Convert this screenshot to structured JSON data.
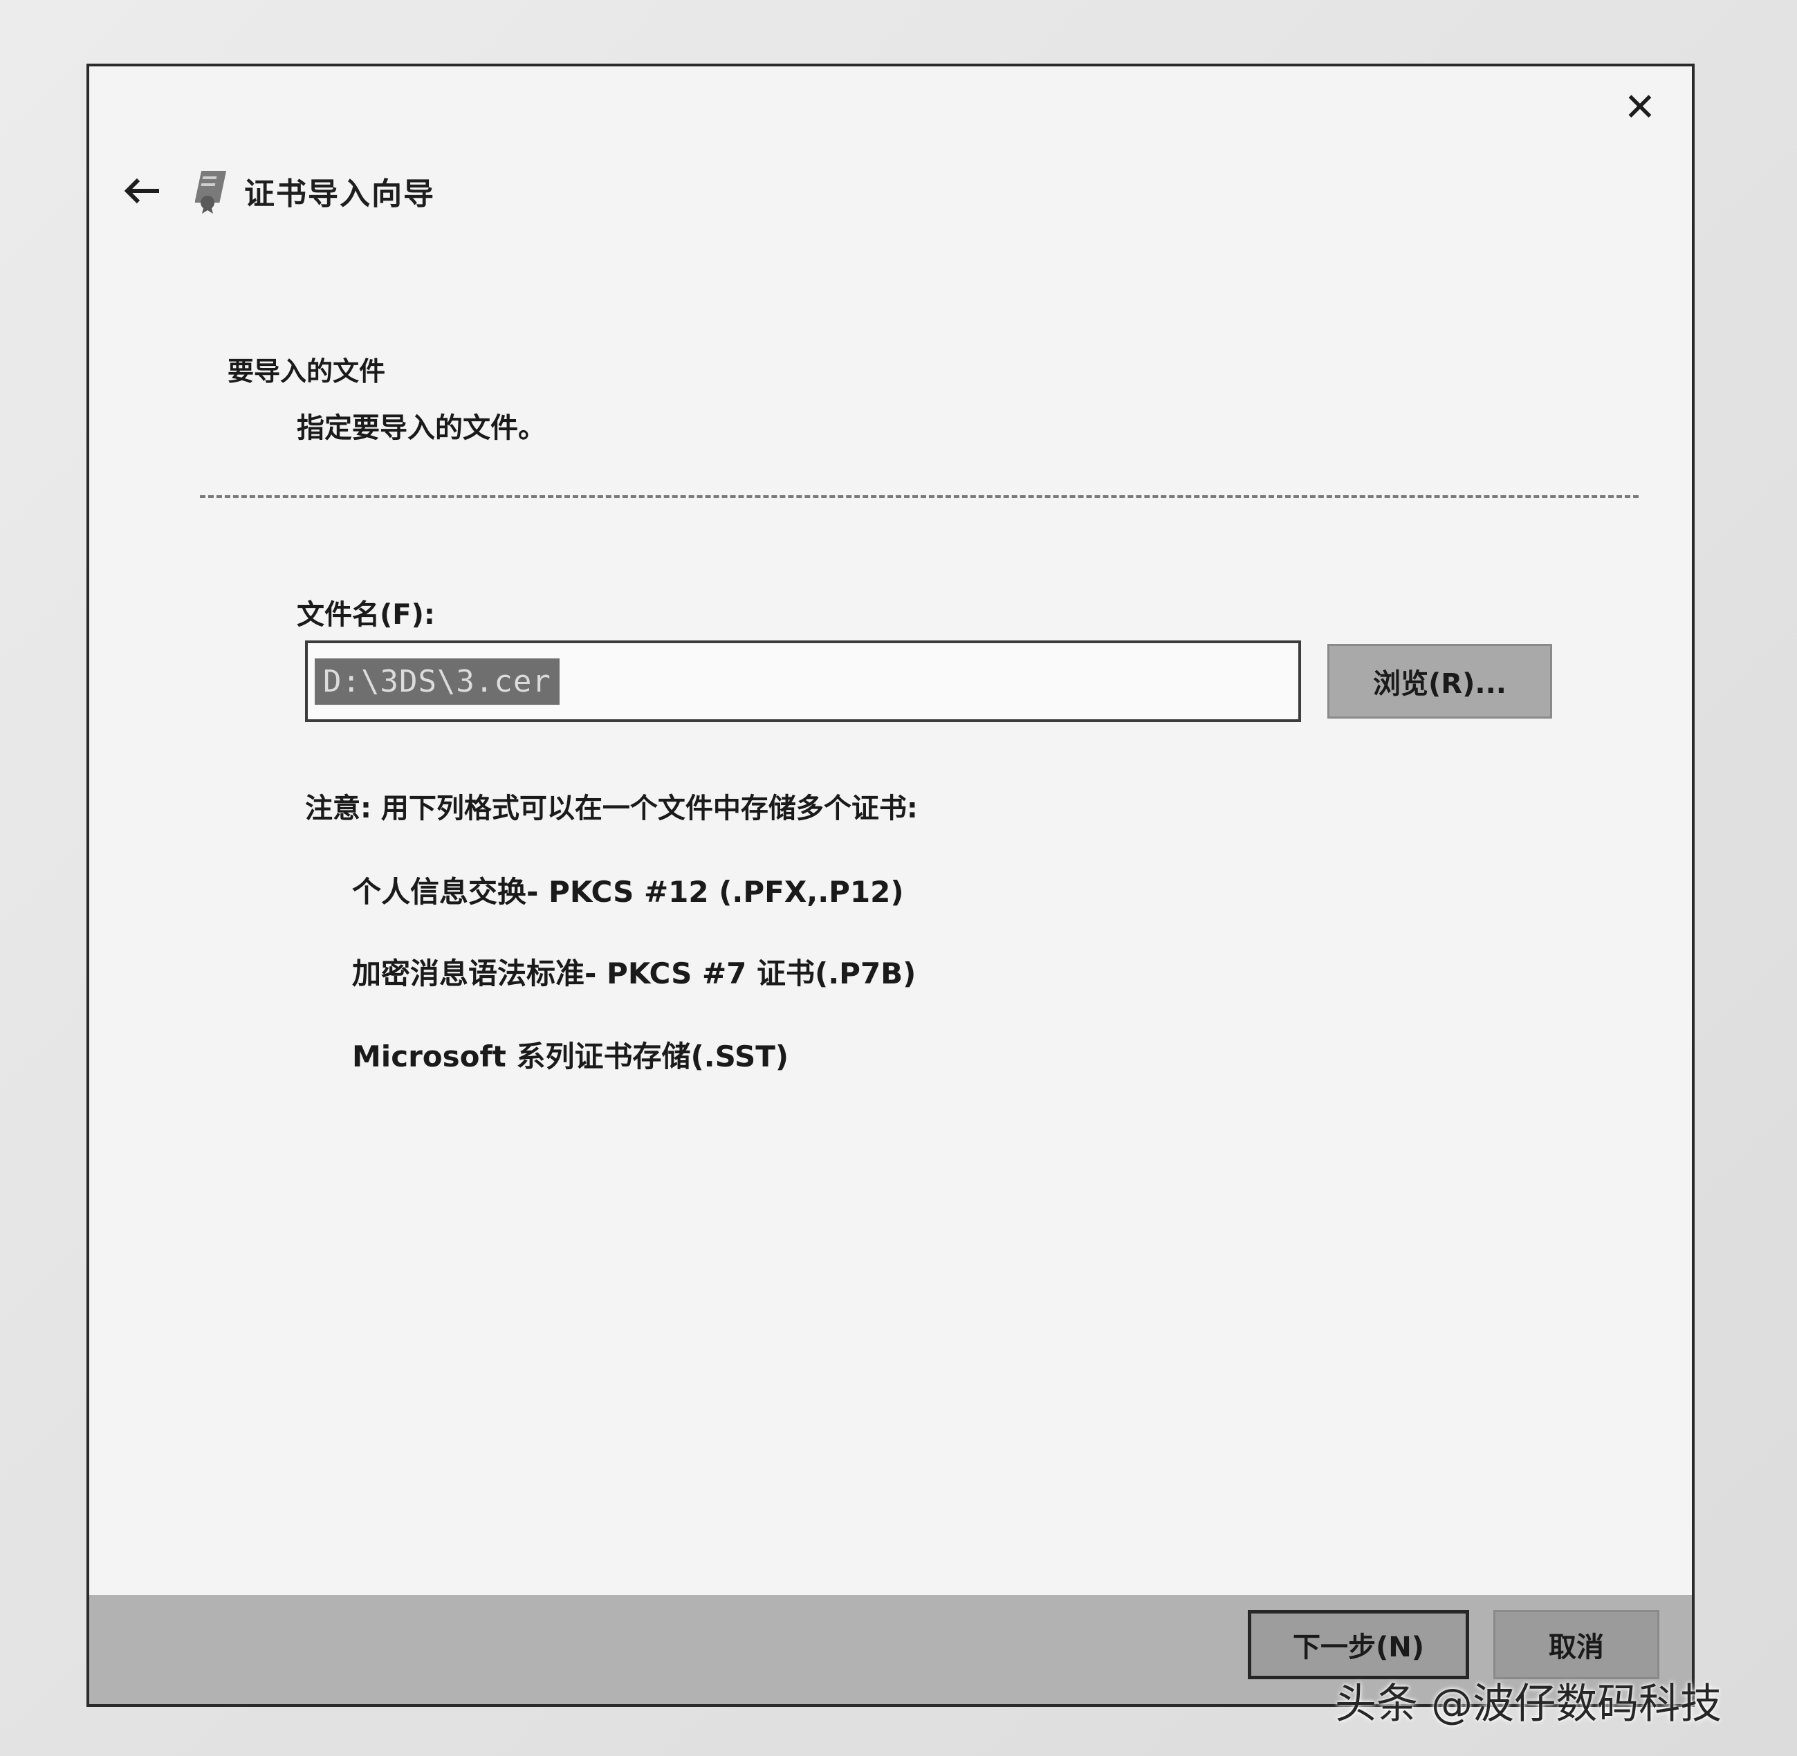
{
  "window": {
    "close_glyph": "✕"
  },
  "header": {
    "title": "证书导入向导"
  },
  "section": {
    "title": "要导入的文件",
    "subtitle": "指定要导入的文件。"
  },
  "file": {
    "label": "文件名(F):",
    "value": "D:\\3DS\\3.cer",
    "browse_label": "浏览(R)..."
  },
  "note": {
    "text": "注意: 用下列格式可以在一个文件中存储多个证书:",
    "formats": [
      "个人信息交换- PKCS #12 (.PFX,.P12)",
      "加密消息语法标准- PKCS #7 证书(.P7B)",
      "Microsoft 系列证书存储(.SST)"
    ]
  },
  "footer": {
    "next_label": "下一步(N)",
    "cancel_label": "取消"
  },
  "watermark": "头条 @波仔数码科技",
  "icons": {
    "back": "back-arrow-icon",
    "wizard": "certificate-icon",
    "close": "close-icon"
  }
}
